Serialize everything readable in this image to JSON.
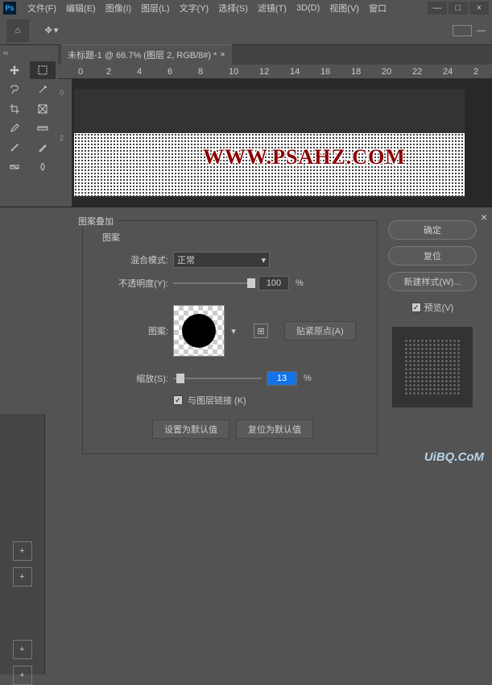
{
  "menu": {
    "file": "文件(F)",
    "edit": "编辑(E)",
    "image": "图像(I)",
    "layer": "图层(L)",
    "type": "文字(Y)",
    "select": "选择(S)",
    "filter": "滤镜(T)",
    "threed": "3D(D)",
    "view": "视图(V)",
    "window": "窗口"
  },
  "tab": {
    "title": "未标题-1 @ 66.7% (图层 2, RGB/8#) *",
    "close": "×"
  },
  "ruler_h": [
    "0",
    "2",
    "4",
    "6",
    "8",
    "10",
    "12",
    "14",
    "16",
    "18",
    "20",
    "22",
    "24",
    "2"
  ],
  "ruler_v": [
    "0",
    "2"
  ],
  "watermark": "WWW.PSAHZ.COM",
  "dialog": {
    "title": "图案叠加",
    "group": "图案",
    "blend_label": "混合模式:",
    "blend_value": "正常",
    "opacity_label": "不透明度(Y):",
    "opacity_value": "100",
    "pct": "%",
    "pattern_label": "图案:",
    "snap_label": "贴紧原点(A)",
    "scale_label": "缩放(S):",
    "scale_value": "13",
    "link_label": "与图层链接 (K)",
    "set_default": "设置为默认值",
    "reset_default": "复位为默认值",
    "ok": "确定",
    "reset": "复位",
    "newstyle": "新建样式(W)...",
    "preview": "预览(V)",
    "close": "×"
  },
  "wm2": "UiBQ.CoM",
  "icons": {
    "ps": "Ps",
    "min": "—",
    "max": "□",
    "close": "×",
    "home": "⌂",
    "move": "✥",
    "dd": "▾",
    "dash": "—",
    "collapse": "‹‹",
    "chk": "✓",
    "plus": "+",
    "tab_x": "×",
    "snap": "⊞"
  }
}
